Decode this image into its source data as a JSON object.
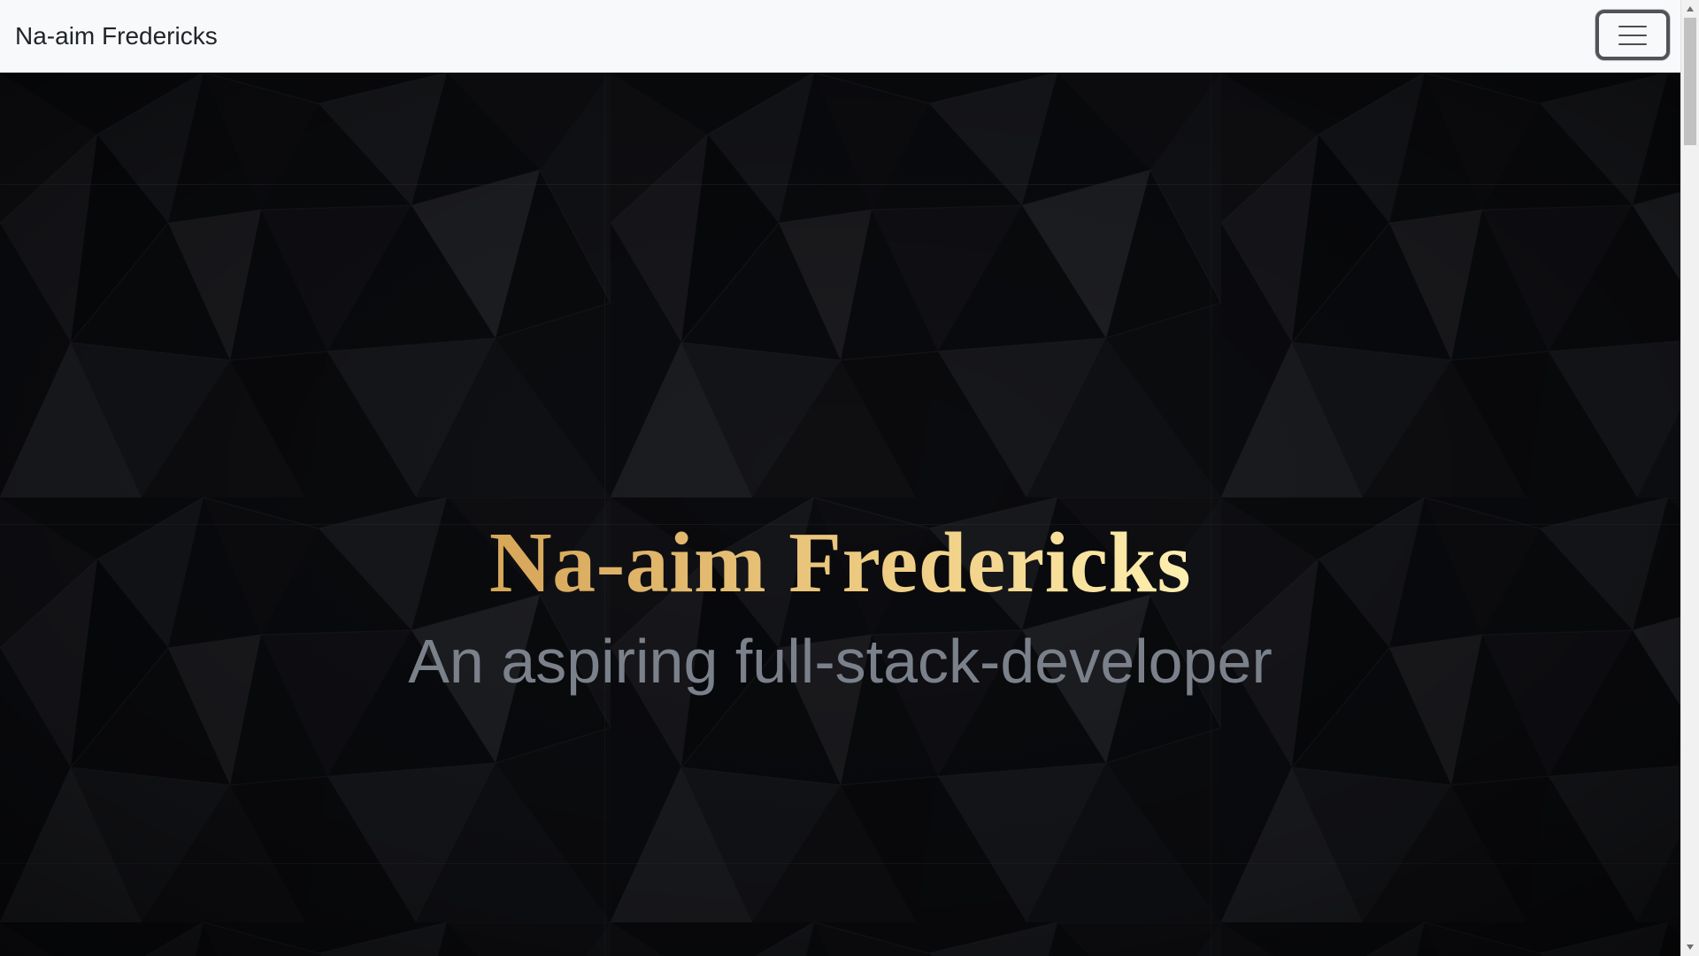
{
  "navbar": {
    "brand": "Na-aim Fredericks",
    "toggle_icon": "hamburger-menu-icon"
  },
  "hero": {
    "title": "Na-aim Fredericks",
    "subtitle": "An aspiring full-stack-developer",
    "background": "dark-low-poly-pattern",
    "title_gradient": [
      "#b8863a",
      "#d7a75a",
      "#f3d58d",
      "#fff2b4",
      "#d4ad62"
    ],
    "subtitle_color": "#7b818b"
  },
  "colors": {
    "navbar_background": "#f8f9fa",
    "brand_text": "#212529",
    "hero_dark": "#0e0f12"
  },
  "scrollbar": {
    "visible": true
  }
}
